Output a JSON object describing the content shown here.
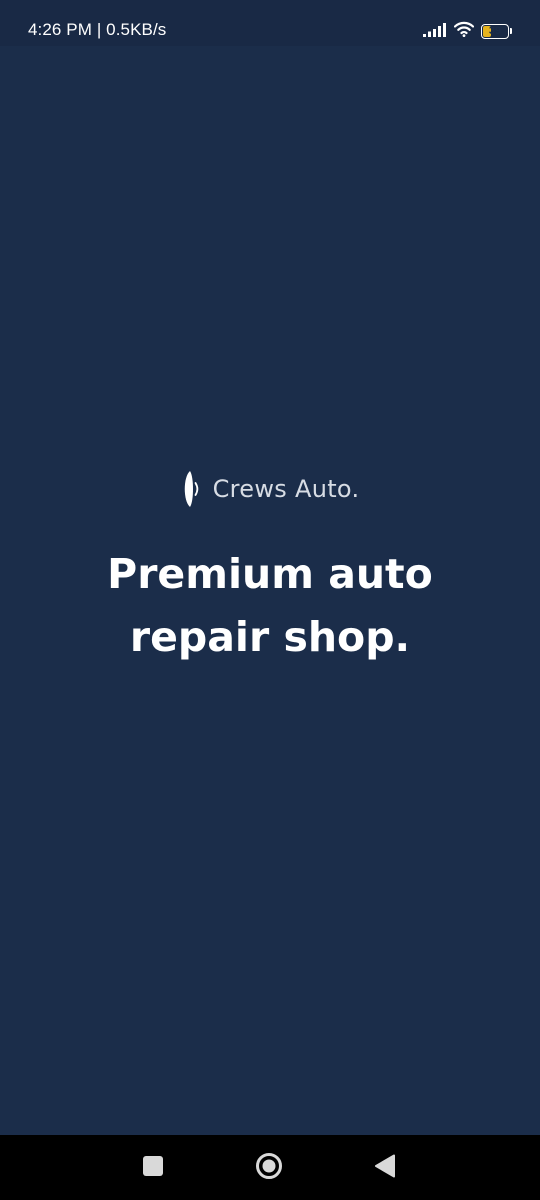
{
  "status_bar": {
    "time_speed": "4:26 PM | 0.5KB/s",
    "battery_level": "39",
    "icons": [
      "signal-icon",
      "wifi-icon",
      "battery-icon"
    ]
  },
  "brand": {
    "name": "Crews Auto.",
    "logo_icon": "crews-logo-icon"
  },
  "tagline": {
    "line1": "Premium auto",
    "line2": "repair shop."
  },
  "nav_bar": {
    "buttons": [
      "recents-button",
      "home-button",
      "back-button"
    ]
  },
  "colors": {
    "background": "#1b2d4a",
    "status_bar": "#192945",
    "brand_text": "#d7dce4",
    "tagline_text": "#ffffff",
    "nav_bar": "#000000",
    "battery_fill": "#e6b31e"
  }
}
